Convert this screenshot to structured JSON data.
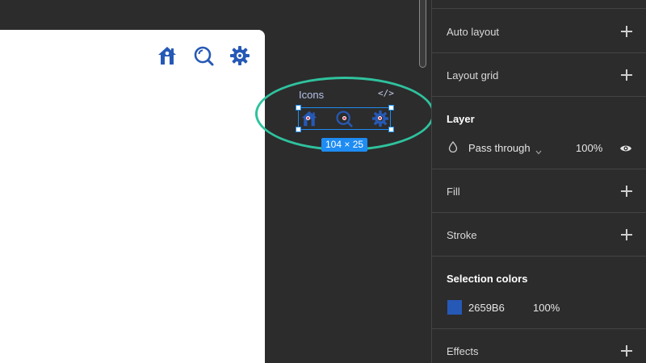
{
  "canvas": {
    "selection": {
      "layer_name": "Icons",
      "code_icon": "</>",
      "dimensions": "104 × 25"
    },
    "icons": [
      "home-icon",
      "search-icon",
      "gear-icon"
    ],
    "icon_color": "#2659B6",
    "selection_color": "#1E8CF2",
    "highlight_color": "#2FC29E"
  },
  "panel": {
    "auto_layout": {
      "label": "Auto layout"
    },
    "layout_grid": {
      "label": "Layout grid"
    },
    "layer": {
      "label": "Layer",
      "blend_mode": "Pass through",
      "opacity": "100%"
    },
    "fill": {
      "label": "Fill"
    },
    "stroke": {
      "label": "Stroke"
    },
    "selection_colors": {
      "label": "Selection colors",
      "hex": "2659B6",
      "opacity": "100%"
    },
    "effects": {
      "label": "Effects"
    }
  }
}
